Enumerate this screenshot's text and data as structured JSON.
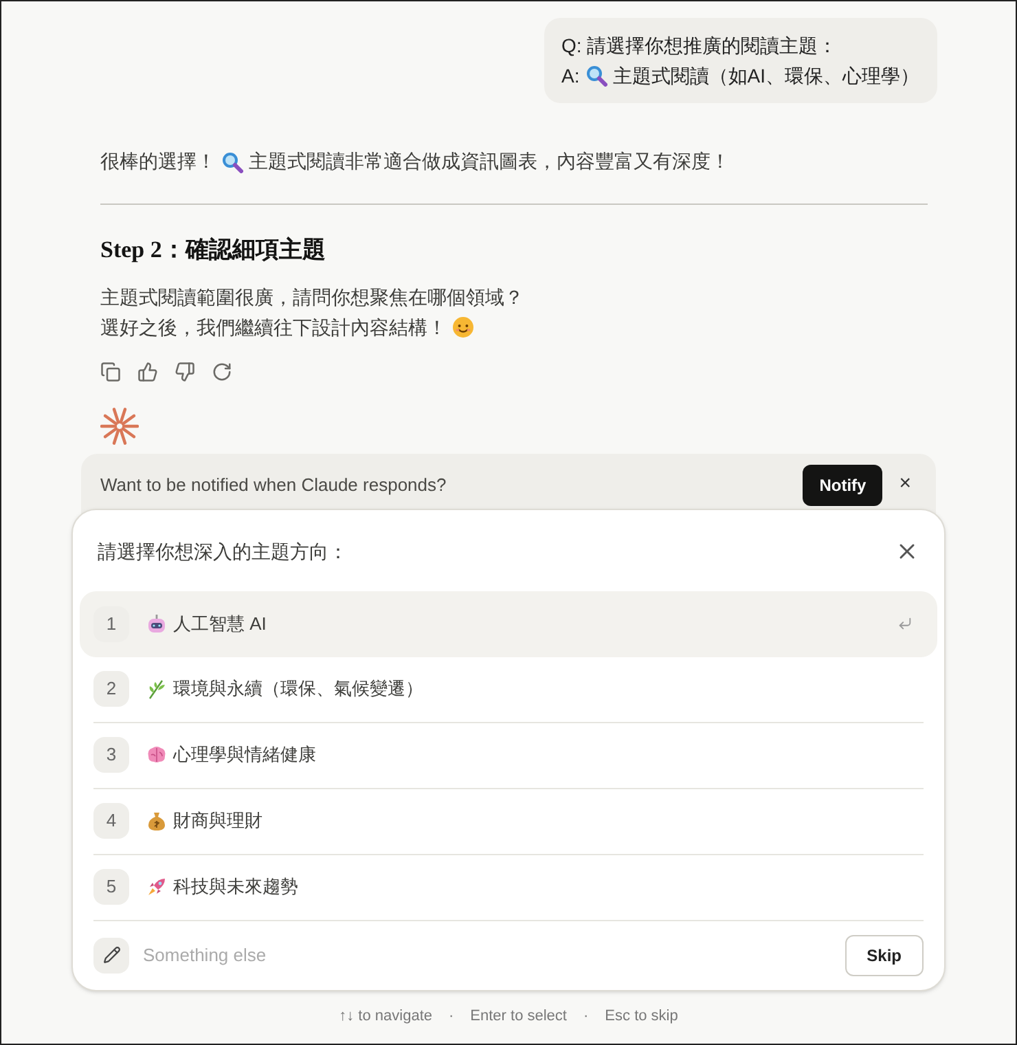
{
  "user_message": {
    "question": "Q: 請選擇你想推廣的閱讀主題：",
    "answer_prefix": "A:",
    "answer": "主題式閱讀（如AI、環保、心理學）"
  },
  "reply": {
    "intro_before": "很棒的選擇！",
    "intro_after": "主題式閱讀非常適合做成資訊圖表，內容豐富又有深度！",
    "heading": "Step 2：確認細項主題",
    "lines": [
      "主題式閱讀範圍很廣，請問你想聚焦在哪個領域？",
      "選好之後，我們繼續往下設計內容結構！"
    ]
  },
  "notify_bar": {
    "text": "Want to be notified when Claude responds?",
    "button": "Notify",
    "close": "×"
  },
  "picker": {
    "title": "請選擇你想深入的主題方向：",
    "options": [
      {
        "number": "1",
        "kind": "robot",
        "label": "人工智慧 AI",
        "selected": true
      },
      {
        "number": "2",
        "kind": "plant",
        "label": "環境與永續（環保、氣候變遷）",
        "selected": false
      },
      {
        "number": "3",
        "kind": "brain",
        "label": "心理學與情緒健康",
        "selected": false
      },
      {
        "number": "4",
        "kind": "moneybag",
        "label": "財商與理財",
        "selected": false
      },
      {
        "number": "5",
        "kind": "rocket",
        "label": "科技與未來趨勢",
        "selected": false
      }
    ],
    "other_placeholder": "Something else",
    "skip": "Skip"
  },
  "hints": [
    "↑↓ to navigate",
    "Enter to select",
    "Esc to skip"
  ],
  "separator": "·"
}
